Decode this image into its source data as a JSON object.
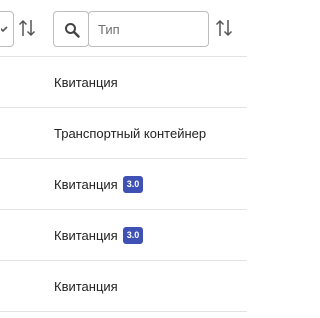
{
  "filters": {
    "type_placeholder": "Тип",
    "type_value": ""
  },
  "rows": [
    {
      "type": "Квитанция",
      "version": null
    },
    {
      "type": "Транспортный контейнер",
      "version": null
    },
    {
      "type": "Квитанция",
      "version": "3.0"
    },
    {
      "type": "Квитанция",
      "version": "3.0"
    },
    {
      "type": "Квитанция",
      "version": null
    }
  ],
  "colors": {
    "badge": "#3f51b5",
    "border": "#e3e3e3",
    "icon": "#555555"
  },
  "icons": {
    "search": "search-icon",
    "sort": "sort-arrows-icon",
    "dropdown": "chevron-down-icon"
  }
}
